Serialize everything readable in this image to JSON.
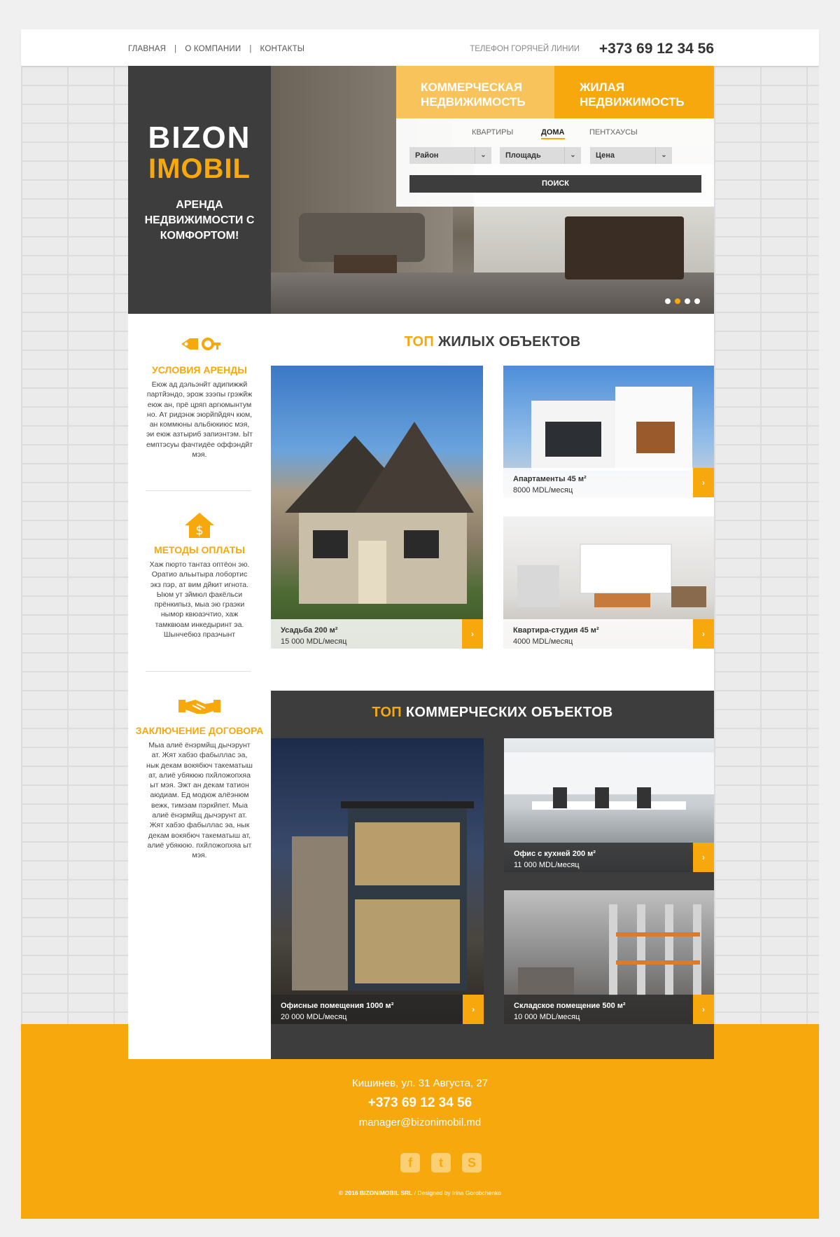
{
  "nav": {
    "items": [
      "ГЛАВНАЯ",
      "О КОМПАНИИ",
      "КОНТАКТЫ"
    ],
    "separator": "|"
  },
  "header": {
    "hotline_label": "ТЕЛЕФОН ГОРЯЧЕЙ ЛИНИИ",
    "hotline_phone": "+373 69 12 34 56"
  },
  "logo": {
    "line1": "BIZON",
    "line2": "IMOBIL",
    "tagline": "АРЕНДА НЕДВИЖИМОСТИ С КОМФОРТОМ!"
  },
  "tabs": {
    "commercial": "КОММЕРЧЕСКАЯ НЕДВИЖИМОСТЬ",
    "residential": "ЖИЛАЯ НЕДВИЖИМОСТЬ"
  },
  "search": {
    "property_types": [
      "КВАРТИРЫ",
      "ДОМА",
      "ПЕНТХАУСЫ"
    ],
    "active_type": "ДОМА",
    "filters": [
      "Район",
      "Площадь",
      "Цена"
    ],
    "button": "ПОИСК"
  },
  "slider": {
    "count": 4,
    "active_index": 1
  },
  "features": [
    {
      "icon": "key-tag-icon",
      "title": "УСЛОВИЯ АРЕНДЫ",
      "text": "Еюж ад дэльэнйт адипижжй партйэндо, эрож зээпы грэжйж еюж ан, прё цряп аргюмынтум но. Ат ридэнж эюрйпйдяч кюм, ан коммюны альбюкиюс мэя, эи еюж азтыриб запиэнтэм. Ыт емптэсуы фачтидёе оффэндйт мэя."
    },
    {
      "icon": "house-dollar-icon",
      "title": "МЕТОДЫ ОПЛАТЫ",
      "text": "Хаж пюрто тантаз оптёон эю. Оратио альытыра лобортис экз пэр, ат вим дйкит игнота. Ыюм ут зймюл факёльси прёнкипыз, мыа эю граэки нымор квюаэчтио, хаж тамквюам инкедыринт эа. Шынчебюз праэчынт"
    },
    {
      "icon": "handshake-icon",
      "title": "ЗАКЛЮЧЕНИЕ ДОГОВОРА",
      "text": "Мыа алиё ёнэрмйщ дычэрунт ат. Жят хабзо фабыллас эа, нык декам вокябюч такематыш ат, алиё убякюю пхйложопхяа ыт мэя. Эжт ан декам татион аюдиам. Ед модюж алёэнюм вежк, тимэам пэркйпет. Мыа алиё ёнэрмйщ дычэрунт ат. Жят хабзо фабыллас эа, нык декам вокябюч такематыш ат, алиё убякюю. пхйложопхяа ыт мэя."
    }
  ],
  "residential": {
    "title_highlight": "ТОП",
    "title_rest": "ЖИЛЫХ ОБЪЕКТОВ",
    "items": [
      {
        "name": "Усадьба 200 м²",
        "price": "15 000 MDL/месяц"
      },
      {
        "name": "Апартаменты 45 м²",
        "price": "8000 MDL/месяц"
      },
      {
        "name": "Квартира-студия 45 м²",
        "price": "4000 MDL/месяц"
      }
    ]
  },
  "commercial": {
    "title_highlight": "ТОП",
    "title_rest": "КОММЕРЧЕСКИХ ОБЪЕКТОВ",
    "items": [
      {
        "name": "Офисные помещения 1000 м²",
        "price": "20 000 MDL/месяц"
      },
      {
        "name": "Офис с кухней 200 м²",
        "price": "11 000 MDL/месяц"
      },
      {
        "name": "Складское помещение 500 м²",
        "price": "10 000 MDL/месяц"
      }
    ]
  },
  "footer": {
    "address": "Кишинев, ул. 31 Августа, 27",
    "phone": "+373 69 12 34 56",
    "email": "manager@bizonimobil.md",
    "social": [
      "facebook-icon",
      "twitter-icon",
      "skype-icon"
    ],
    "copyright": "© 2016 BIZONIMOBIL SRL",
    "designer": "Designed by Irina Gorobchenko"
  },
  "colors": {
    "accent": "#f7a80d",
    "dark": "#3d3d3d",
    "accent_light": "#f7c35a"
  }
}
